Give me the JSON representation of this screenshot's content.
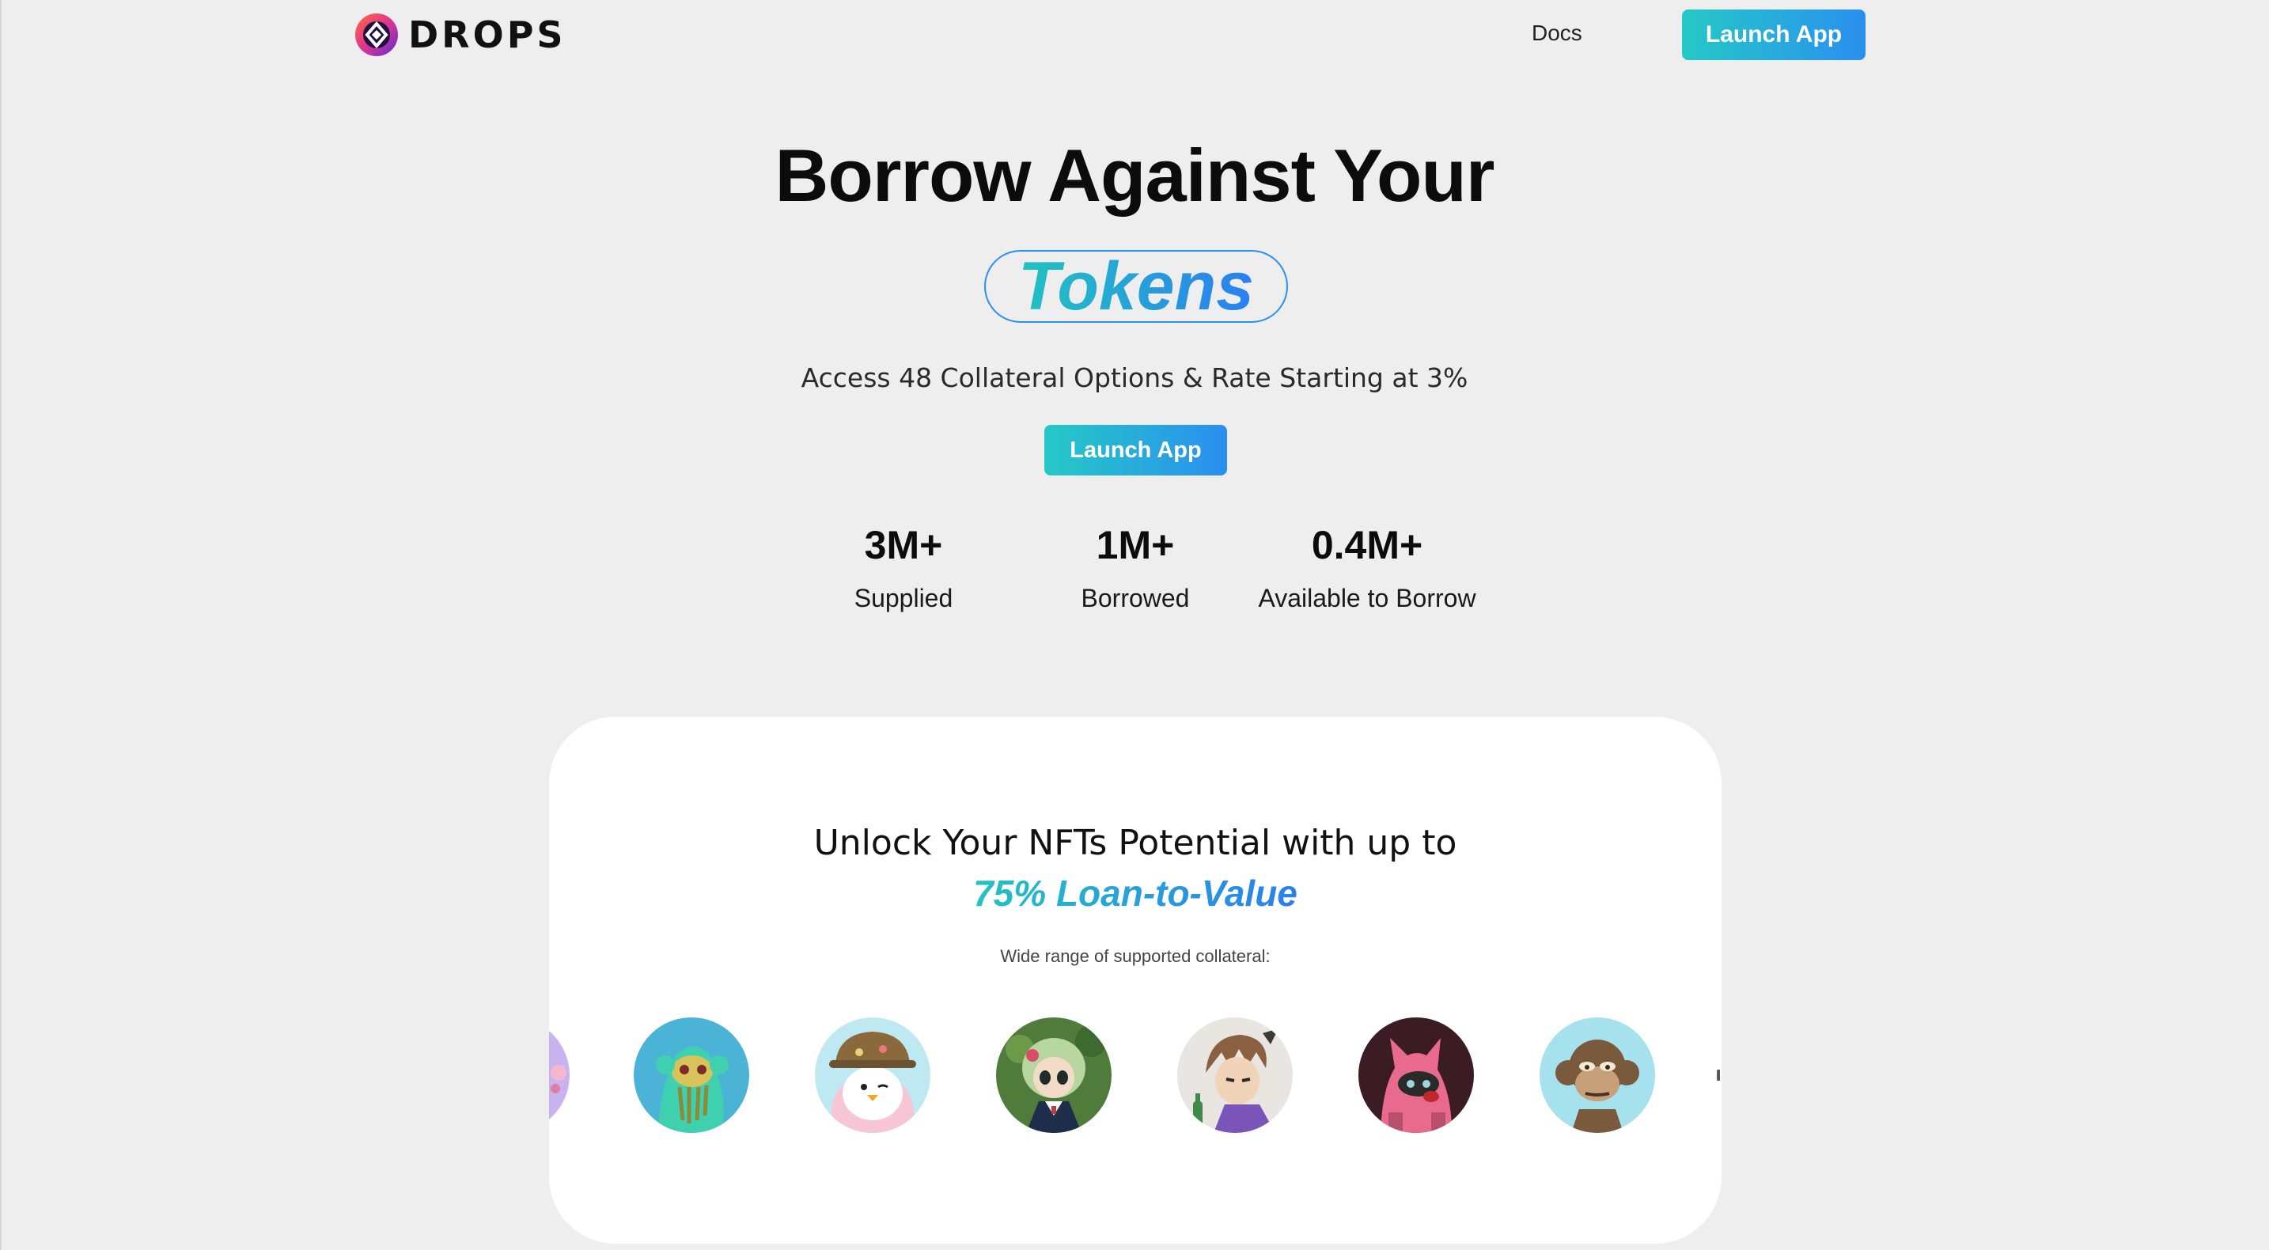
{
  "header": {
    "brand": "DROPS",
    "nav_docs": "Docs",
    "launch_label": "Launch App"
  },
  "hero": {
    "title_line1": "Borrow Against Your",
    "title_highlight": "Tokens",
    "subtitle": "Access 48 Collateral Options & Rate Starting at 3%",
    "cta_label": "Launch App"
  },
  "stats": [
    {
      "value": "3M+",
      "label": "Supplied"
    },
    {
      "value": "1M+",
      "label": "Borrowed"
    },
    {
      "value": "0.4M+",
      "label": "Available to Borrow"
    }
  ],
  "collateral": {
    "title": "Unlock Your NFTs Potential with up to",
    "highlight": "75% Loan-to-Value",
    "caption": "Wide range of supported collateral:",
    "items": [
      {
        "icon": "nft-partial-left-icon",
        "bg": "#c9b3ef"
      },
      {
        "icon": "mutant-ape-nft-icon",
        "bg": "#4ab3d6"
      },
      {
        "icon": "pudgy-penguin-nft-icon",
        "bg": "#bfe9f2"
      },
      {
        "icon": "azuki-girl-nft-icon",
        "bg": "#4f7c3b"
      },
      {
        "icon": "azuki-boy-nft-icon",
        "bg": "#e9e6e2"
      },
      {
        "icon": "pink-wolf-nft-icon",
        "bg": "#3a1c22"
      },
      {
        "icon": "bored-ape-nft-icon",
        "bg": "#a6e2ee"
      }
    ]
  },
  "colors": {
    "accent_start": "#25c9c6",
    "accent_end": "#2a8ff0",
    "page_bg": "#eeeeee",
    "card_bg": "#ffffff"
  }
}
